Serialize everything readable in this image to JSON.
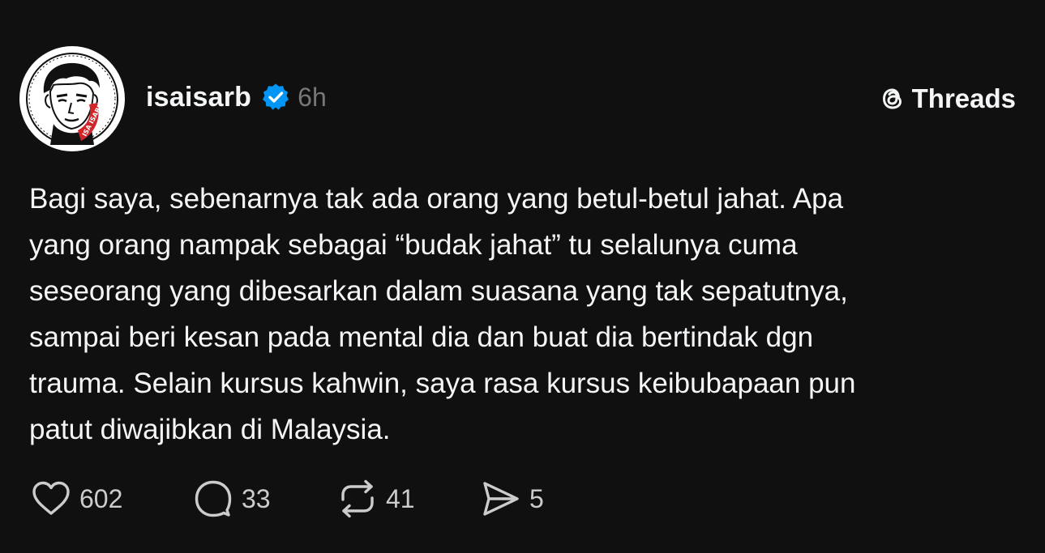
{
  "author": {
    "username": "isaisarb",
    "verified": true,
    "time_ago": "6h",
    "avatar_badge": "ISA ISARB"
  },
  "brand": {
    "icon": "threads-logo-icon",
    "name": "Threads"
  },
  "post": {
    "lines": [
      "Bagi saya, sebenarnya tak ada orang yang betul-betul jahat. Apa",
      "yang orang nampak sebagai “budak jahat” tu selalunya cuma",
      "seseorang yang dibesarkan dalam suasana yang tak sepatutnya,",
      "sampai beri kesan pada mental dia dan buat dia bertindak dgn",
      "trauma. Selain kursus kahwin, saya rasa kursus keibubapaan pun",
      "patut diwajibkan di Malaysia."
    ]
  },
  "actions": {
    "like": {
      "icon": "heart-icon",
      "count": "602"
    },
    "reply": {
      "icon": "comment-icon",
      "count": "33"
    },
    "repost": {
      "icon": "repost-icon",
      "count": "41"
    },
    "share": {
      "icon": "send-icon",
      "count": "5"
    }
  },
  "colors": {
    "background": "#101010",
    "text": "#f3f5f7",
    "muted": "#777777",
    "verified": "#0095f6",
    "badge_red": "#d0262a"
  }
}
